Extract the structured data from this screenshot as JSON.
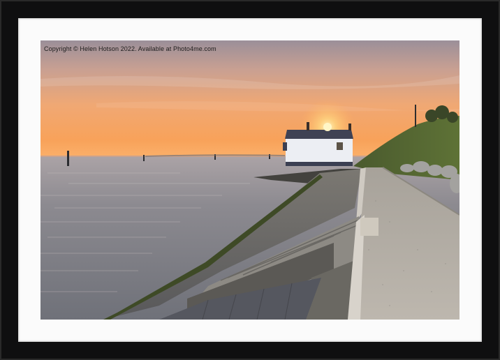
{
  "watermark": {
    "copyright": "Copyright © Helen Hotson 2022. Available at Photo4me.com"
  },
  "colors": {
    "frame": "#0f0f10",
    "mount": "#fbfbfb",
    "sky_top": "#9c8f98",
    "sky_horizon": "#f7a45e",
    "sea": "#7c7e86",
    "sun": "#fff1b0"
  },
  "scene": {
    "subject": "white boathouse at sunset on the seafront promenade"
  }
}
